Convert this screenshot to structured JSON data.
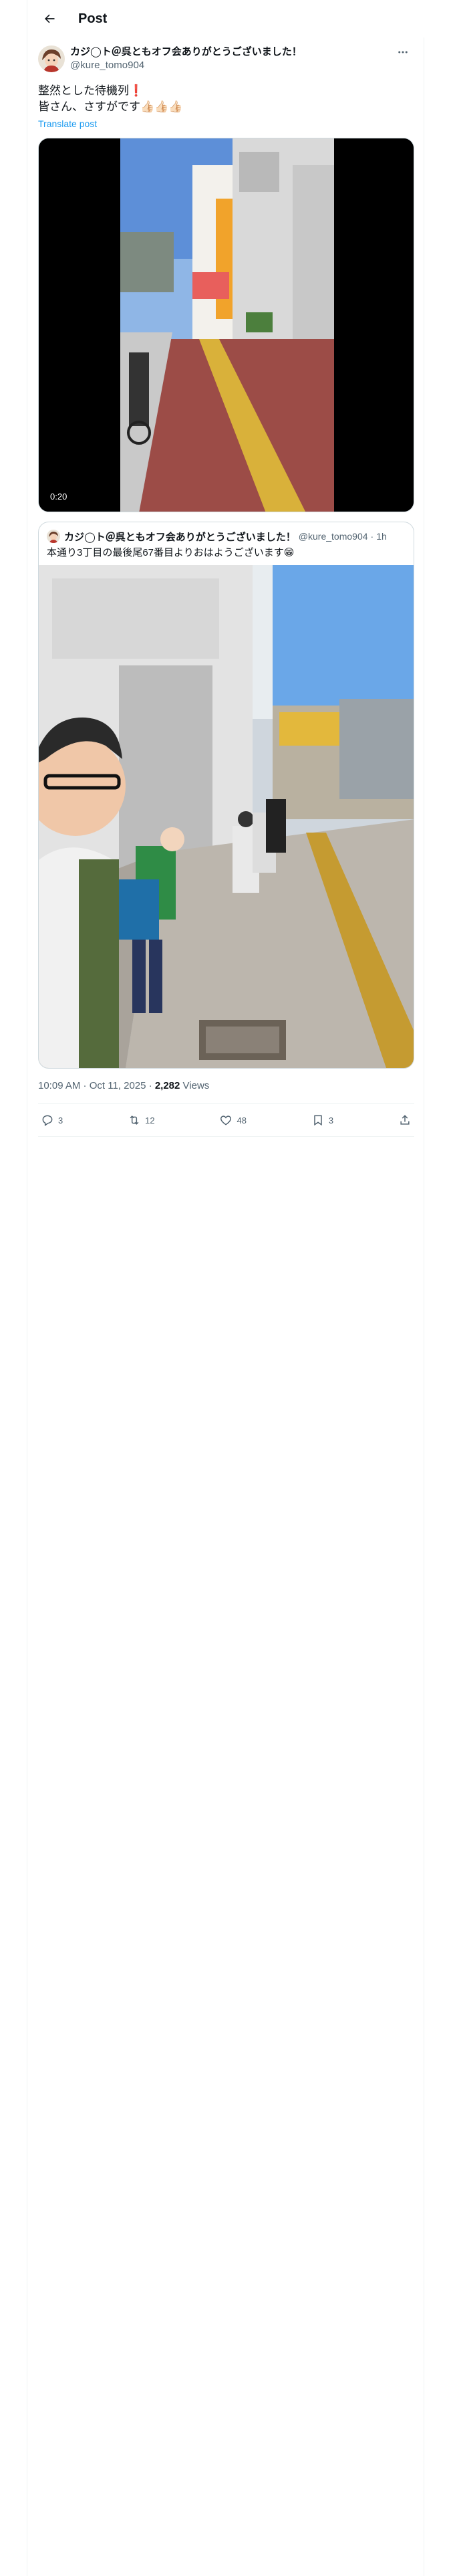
{
  "header": {
    "title": "Post"
  },
  "post": {
    "author_name": "カジ◯ト＠呉ともオフ会ありがとうございました！",
    "author_handle": "@kure_tomo904",
    "text_line1": "整然とした待機列❗",
    "text_line2": "皆さん、さすがです👍🏻👍🏻👍🏻",
    "translate_label": "Translate post",
    "video_time": "0:20"
  },
  "quote": {
    "author_name": "カジ◯ト＠呉ともオフ会ありがとうございました！",
    "author_handle": "@kure_tomo904",
    "time": "1h",
    "text": "本通り3丁目の最後尾67番目よりおはようございます😁"
  },
  "meta": {
    "time": "10:09 AM · Oct 11, 2025",
    "separator": "·",
    "views_count": "2,282",
    "views_label": "Views"
  },
  "actions": {
    "replies": "3",
    "reposts": "12",
    "likes": "48",
    "bookmarks": "3"
  },
  "colors": {
    "accent": "#1d9bf0",
    "text": "#0f1419",
    "secondary": "#536471",
    "border": "#cfd9de"
  },
  "icons": [
    "back-arrow-icon",
    "more-icon",
    "reply-icon",
    "repost-icon",
    "like-icon",
    "bookmark-icon",
    "share-icon"
  ]
}
